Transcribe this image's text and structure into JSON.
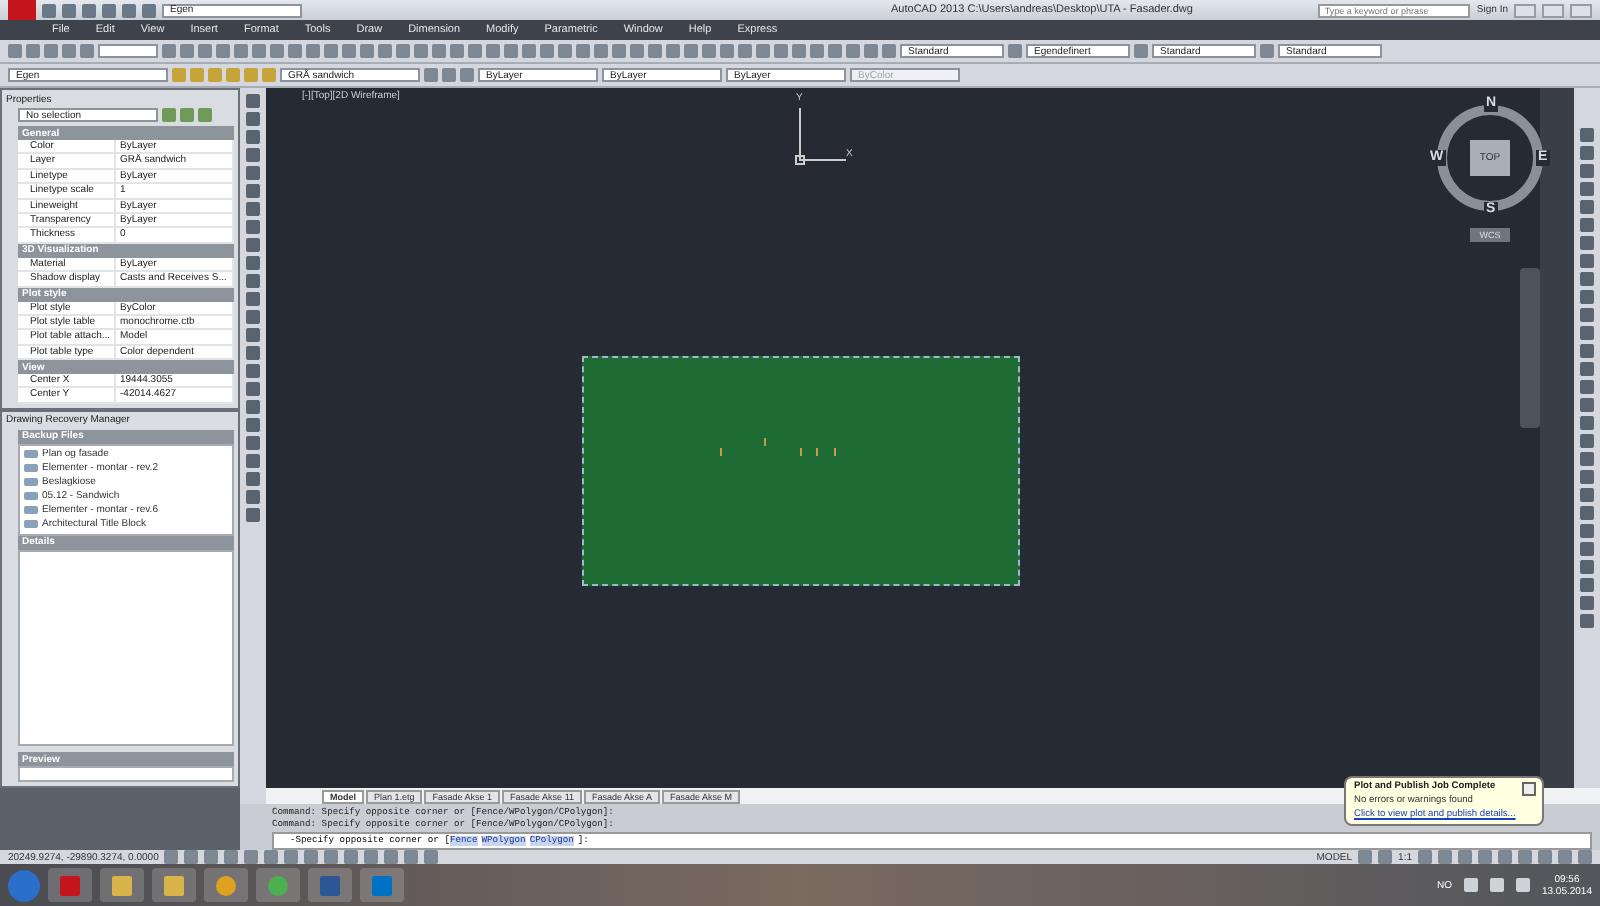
{
  "window": {
    "title": "AutoCAD 2013   C:\\Users\\andreas\\Desktop\\UTA - Fasader.dwg",
    "workspace": "Egen",
    "search_placeholder": "Type a keyword or phrase",
    "sign_in": "Sign In"
  },
  "menu": [
    "File",
    "Edit",
    "View",
    "Insert",
    "Format",
    "Tools",
    "Draw",
    "Dimension",
    "Modify",
    "Parametric",
    "Window",
    "Help",
    "Express"
  ],
  "style_toolbar": [
    {
      "label": "Standard"
    },
    {
      "label": "Egendefinert"
    },
    {
      "label": "Standard"
    },
    {
      "label": "Standard"
    }
  ],
  "layer_toolbar": {
    "workspace": "Egen",
    "layer": "GRÅ sandwich",
    "color_control": "ByLayer",
    "linetype": "ByLayer",
    "lineweight": "ByLayer",
    "plot_style": "ByColor"
  },
  "properties": {
    "title": "Properties",
    "selection": "No selection",
    "sections": [
      {
        "title": "General",
        "rows": [
          {
            "label": "Color",
            "value": "ByLayer"
          },
          {
            "label": "Layer",
            "value": "GRÅ sandwich"
          },
          {
            "label": "Linetype",
            "value": "ByLayer"
          },
          {
            "label": "Linetype scale",
            "value": "1"
          },
          {
            "label": "Lineweight",
            "value": "ByLayer"
          },
          {
            "label": "Transparency",
            "value": "ByLayer"
          },
          {
            "label": "Thickness",
            "value": "0"
          }
        ]
      },
      {
        "title": "3D Visualization",
        "rows": [
          {
            "label": "Material",
            "value": "ByLayer"
          },
          {
            "label": "Shadow display",
            "value": "Casts and Receives S..."
          }
        ]
      },
      {
        "title": "Plot style",
        "rows": [
          {
            "label": "Plot style",
            "value": "ByColor"
          },
          {
            "label": "Plot style table",
            "value": "monochrome.ctb"
          },
          {
            "label": "Plot table attach...",
            "value": "Model"
          },
          {
            "label": "Plot table type",
            "value": "Color dependent"
          }
        ]
      },
      {
        "title": "View",
        "rows": [
          {
            "label": "Center X",
            "value": "19444.3055"
          },
          {
            "label": "Center Y",
            "value": "-42014.4627"
          }
        ]
      }
    ]
  },
  "recovery": {
    "title": "Drawing Recovery Manager",
    "backup_title": "Backup Files",
    "files": [
      "Plan og fasade",
      "Elementer - montar - rev.2",
      "Beslagkiose",
      "05.12 - Sandwich",
      "Elementer - montar - rev.6",
      "Architectural Title Block"
    ],
    "details_title": "Details",
    "preview_title": "Preview"
  },
  "viewport": {
    "label": "[-][Top][2D Wireframe]",
    "axis_x": "X",
    "axis_y": "Y",
    "compass": {
      "north": "N",
      "south": "S",
      "east": "E",
      "west": "W",
      "face": "TOP",
      "ucs": "WCS"
    }
  },
  "layout_tabs": [
    {
      "label": "Model",
      "selected": true
    },
    {
      "label": "Plan 1.etg",
      "selected": false
    },
    {
      "label": "Fasade Akse 1",
      "selected": false
    },
    {
      "label": "Fasade Akse 11",
      "selected": false
    },
    {
      "label": "Fasade Akse A",
      "selected": false
    },
    {
      "label": "Fasade Akse M",
      "selected": false
    }
  ],
  "command": {
    "history": [
      "Command: Specify opposite corner or [Fence/WPolygon/CPolygon]:",
      "Command: Specify opposite corner or [Fence/WPolygon/CPolygon]:"
    ],
    "prompt": "-Specify opposite corner or [",
    "options": [
      "Fence",
      "WPolygon",
      "CPolygon"
    ],
    "prompt_end": "]:"
  },
  "status_bar": {
    "coordinates": "20249.9274, -29890.3274, 0.0000",
    "space": "MODEL",
    "scale": "1:1"
  },
  "notification": {
    "title": "Plot and Publish Job Complete",
    "message": "No errors or warnings found",
    "link": "Click to view plot and publish details..."
  },
  "taskbar": {
    "language": "NO",
    "time": "09:56",
    "date": "13.05.2014"
  }
}
